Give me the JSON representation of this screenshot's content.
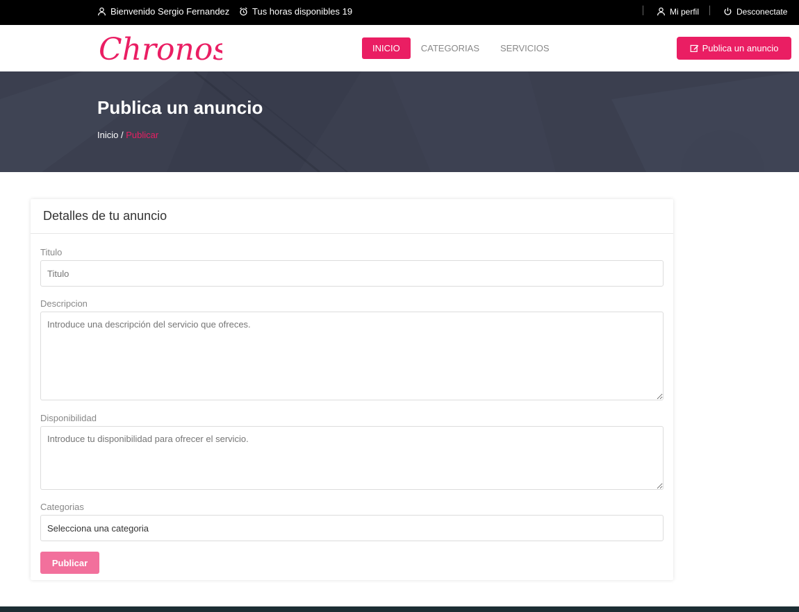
{
  "topbar": {
    "welcome": "Bienvenido Sergio Fernandez",
    "hours": "Tus horas disponibles 19",
    "profile": "Mi perfil",
    "logout": "Desconectate"
  },
  "nav": {
    "logo_text": "Chronos",
    "links": [
      "INICIO",
      "CATEGORIAS",
      "SERVICIOS"
    ],
    "post_button": "Publica un anuncio"
  },
  "hero": {
    "title": "Publica un anuncio",
    "breadcrumb_home": "Inicio /",
    "breadcrumb_current": "Publicar"
  },
  "form": {
    "card_title": "Detalles de tu anuncio",
    "title_label": "Titulo",
    "title_placeholder": "Titulo",
    "description_label": "Descripcion",
    "description_placeholder": "Introduce una descripción del servicio que ofreces.",
    "availability_label": "Disponibilidad",
    "availability_placeholder": "Introduce tu disponibilidad para ofrecer el servicio.",
    "categories_label": "Categorias",
    "categories_selected": "Selecciona una categoria",
    "submit_label": "Publicar"
  },
  "colors": {
    "accent": "#ea1e63",
    "hero_bg": "#3b3f4f",
    "topbar_bg": "#000000",
    "submit_bg": "#f2709c"
  }
}
